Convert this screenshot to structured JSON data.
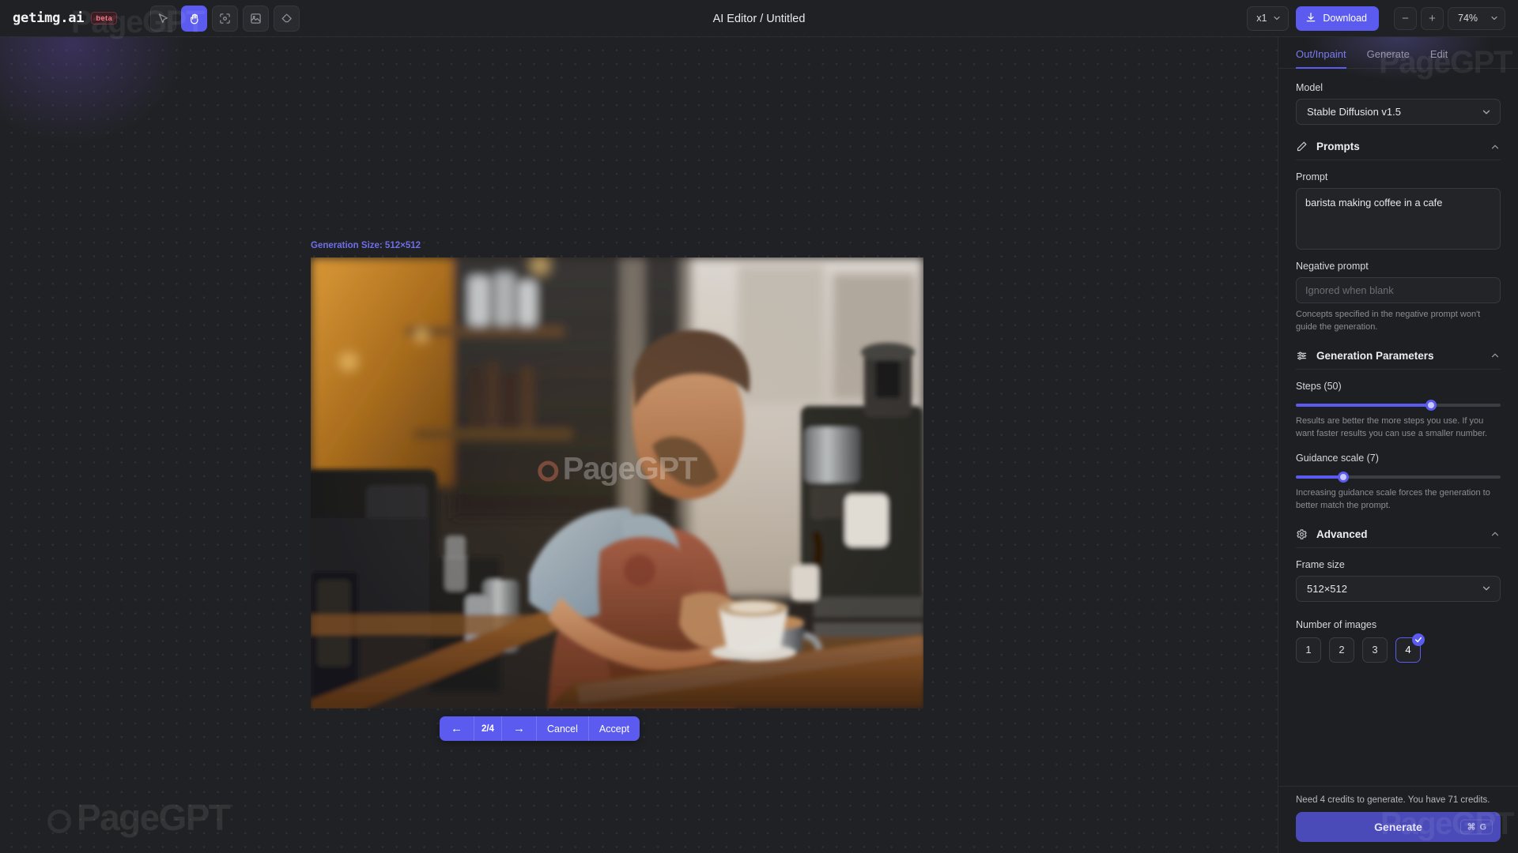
{
  "header": {
    "brand_name": "getimg.ai",
    "beta_badge": "beta",
    "doc_title": "AI Editor / Untitled",
    "tools": [
      {
        "name": "cursor-tool",
        "icon": "cursor-icon",
        "active": false
      },
      {
        "name": "hand-tool",
        "icon": "hand-icon",
        "active": true
      },
      {
        "name": "frame-tool",
        "icon": "frame-icon",
        "active": false
      },
      {
        "name": "image-tool",
        "icon": "image-icon",
        "active": false
      },
      {
        "name": "eraser-tool",
        "icon": "eraser-icon",
        "active": false
      }
    ],
    "scale_value": "x1",
    "download_label": "Download",
    "zoom_out_label": "−",
    "zoom_in_label": "+",
    "zoom_level": "74%"
  },
  "canvas": {
    "generation_size_label": "Generation Size: 512×512",
    "watermark": "PageGPT",
    "image_alt": "barista making coffee in a cafe",
    "nav": {
      "prev_label": "←",
      "counter": "2/4",
      "next_label": "→",
      "cancel_label": "Cancel",
      "accept_label": "Accept"
    }
  },
  "panel": {
    "tabs": [
      {
        "label": "Out/Inpaint",
        "active": true
      },
      {
        "label": "Generate",
        "active": false
      },
      {
        "label": "Edit",
        "active": false
      }
    ],
    "model": {
      "label": "Model",
      "value": "Stable Diffusion v1.5"
    },
    "prompts": {
      "section_title": "Prompts",
      "prompt_label": "Prompt",
      "prompt_value": "barista making coffee in a cafe",
      "negative_label": "Negative prompt",
      "negative_placeholder": "Ignored when blank",
      "negative_value": "",
      "negative_hint": "Concepts specified in the negative prompt won't guide the generation."
    },
    "generation_parameters": {
      "section_title": "Generation Parameters",
      "steps_label": "Steps (50)",
      "steps_percent": 66,
      "steps_hint": "Results are better the more steps you use. If you want faster results you can use a smaller number.",
      "guidance_label": "Guidance scale (7)",
      "guidance_percent": 23,
      "guidance_hint": "Increasing guidance scale forces the generation to better match the prompt."
    },
    "advanced": {
      "section_title": "Advanced",
      "frame_size_label": "Frame size",
      "frame_size_value": "512×512",
      "number_of_images_label": "Number of images",
      "number_options": [
        "1",
        "2",
        "3",
        "4"
      ],
      "number_selected": "4"
    },
    "footer": {
      "credits_text": "Need 4 credits to generate. You have 71 credits.",
      "generate_label": "Generate",
      "shortcut_mod": "⌘",
      "shortcut_key": "G"
    },
    "watermark": "PageGPT"
  },
  "colors": {
    "accent": "#5b5bf0",
    "accent_text": "#7b7bf2",
    "panel_bg": "#1e1f22",
    "canvas_bg": "#202124",
    "beta_red": "#f0717c"
  }
}
